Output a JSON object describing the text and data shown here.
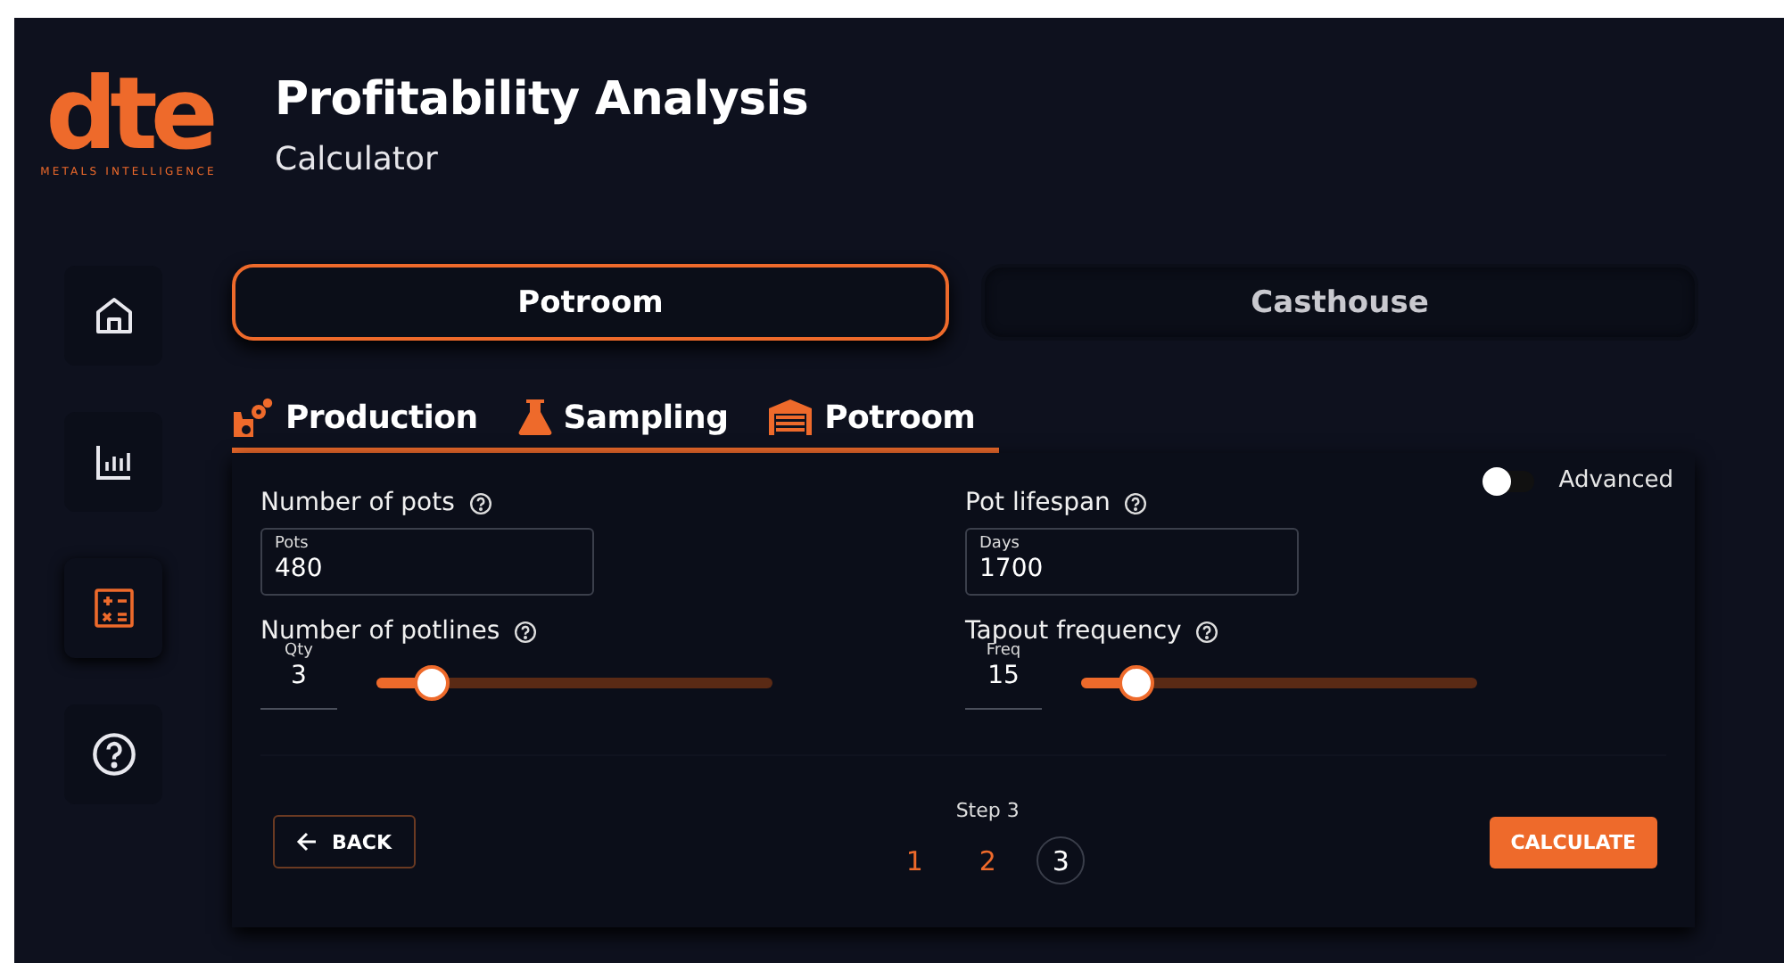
{
  "logo": {
    "letters": "dte",
    "tagline": "METALS INTELLIGENCE"
  },
  "header": {
    "title": "Profitability Analysis",
    "subtitle": "Calculator"
  },
  "sidebar": {
    "items": [
      {
        "kind": "home",
        "selected": false
      },
      {
        "kind": "chart",
        "selected": false
      },
      {
        "kind": "calculator",
        "selected": true
      },
      {
        "kind": "help",
        "selected": false
      }
    ]
  },
  "section_tabs": [
    {
      "label": "Potroom",
      "selected": true
    },
    {
      "label": "Casthouse",
      "selected": false
    }
  ],
  "step_tabs": [
    {
      "kind": "production",
      "label": "Production"
    },
    {
      "kind": "sampling",
      "label": "Sampling"
    },
    {
      "kind": "potroom",
      "label": "Potroom"
    }
  ],
  "advanced_toggle": {
    "label": "Advanced",
    "on": false
  },
  "fields": [
    {
      "kind": "input",
      "label": "Number of pots",
      "field_label": "Pots",
      "value": "480"
    },
    {
      "kind": "input",
      "label": "Pot lifespan",
      "field_label": "Days",
      "value": "1700"
    },
    {
      "kind": "slider",
      "label": "Number of potlines",
      "field_label": "Qty",
      "value": "3",
      "level": 0.14
    },
    {
      "kind": "slider",
      "label": "Tapout frequency",
      "field_label": "Freq",
      "value": "15",
      "level": 0.14
    }
  ],
  "back_button": "BACK",
  "stepper": {
    "caption": "Step 3",
    "steps": [
      {
        "label": "1",
        "selected": false
      },
      {
        "label": "2",
        "selected": false
      },
      {
        "label": "3",
        "selected": true
      }
    ]
  },
  "calculate_button": "CALCULATE"
}
